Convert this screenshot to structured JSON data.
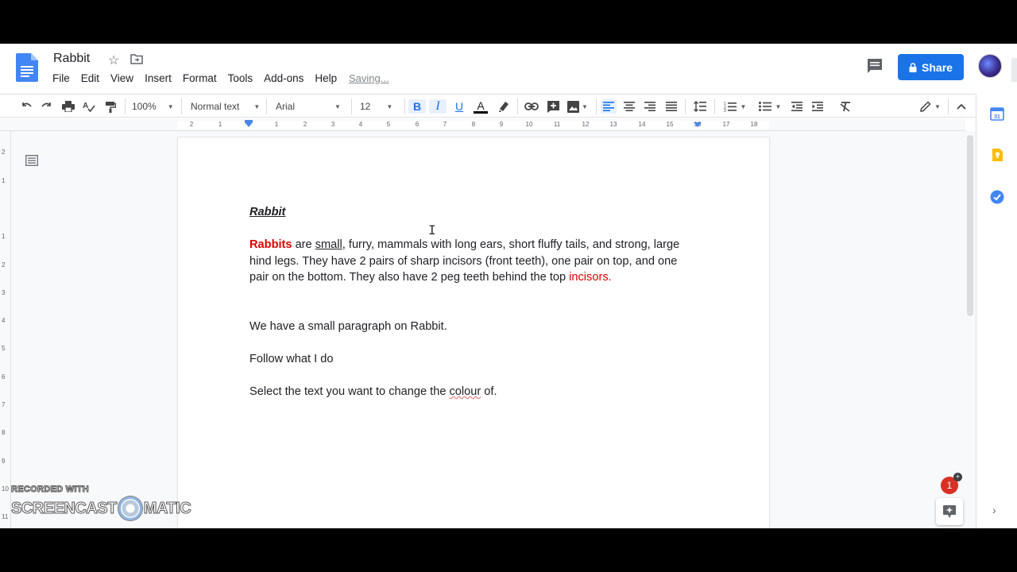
{
  "header": {
    "doc_title": "Rabbit",
    "menu": [
      "File",
      "Edit",
      "View",
      "Insert",
      "Format",
      "Tools",
      "Add-ons",
      "Help"
    ],
    "save_status": "Saving...",
    "share_label": "Share"
  },
  "toolbar": {
    "zoom": "100%",
    "style": "Normal text",
    "font": "Arial",
    "font_size": "12",
    "bold_label": "B",
    "italic_label": "I",
    "underline_label": "U",
    "text_color_label": "A"
  },
  "ruler": {
    "numbers": [
      "2",
      "1",
      "1",
      "2",
      "3",
      "4",
      "5",
      "6",
      "7",
      "8",
      "9",
      "10",
      "11",
      "12",
      "13",
      "14",
      "15",
      "16",
      "17",
      "18"
    ],
    "vertical_numbers": [
      "2",
      "1",
      "1",
      "2",
      "3",
      "4",
      "5",
      "6",
      "7",
      "8",
      "9",
      "10",
      "11"
    ]
  },
  "document": {
    "heading": "Rabbit",
    "para1": {
      "word_red": "Rabbits",
      "t1": " are ",
      "word_ul": "small",
      "t2": ", furry, mammals with long ears, short fluffy tails, and strong, large",
      "line2": "hind legs. They have 2 pairs of sharp incisors (front teeth), one pair on top, and one",
      "line3a": "pair on the bottom. They also have 2 peg teeth behind the top ",
      "line3_red": "incisors."
    },
    "line_small_paragraph": "We have a small paragraph on Rabbit.",
    "line_follow": "Follow what I do",
    "line_select_a": "Select the text you want to change the ",
    "line_select_spell": "colour",
    "line_select_b": " of."
  },
  "notifications": {
    "badge_count": "1",
    "plus": "+"
  },
  "watermark": {
    "top": "RECORDED WITH",
    "left": "SCREENCAST",
    "right": "MATIC"
  },
  "colors": {
    "accent": "#1a73e8",
    "text_red": "#e00000",
    "badge_red": "#d93025"
  },
  "icons": [
    "docs-logo",
    "star-icon",
    "move-folder-icon",
    "comment-icon",
    "lock-icon",
    "undo-icon",
    "redo-icon",
    "print-icon",
    "spellcheck-icon",
    "paint-format-icon",
    "highlight-icon",
    "link-icon",
    "insert-comment-icon",
    "image-icon",
    "align-left-icon",
    "align-center-icon",
    "align-right-icon",
    "justify-icon",
    "line-spacing-icon",
    "numbered-list-icon",
    "bulleted-list-icon",
    "decrease-indent-icon",
    "increase-indent-icon",
    "clear-formatting-icon",
    "edit-mode-icon",
    "collapse-icon",
    "outline-icon",
    "calendar-icon",
    "keep-icon",
    "tasks-icon",
    "explore-icon"
  ]
}
